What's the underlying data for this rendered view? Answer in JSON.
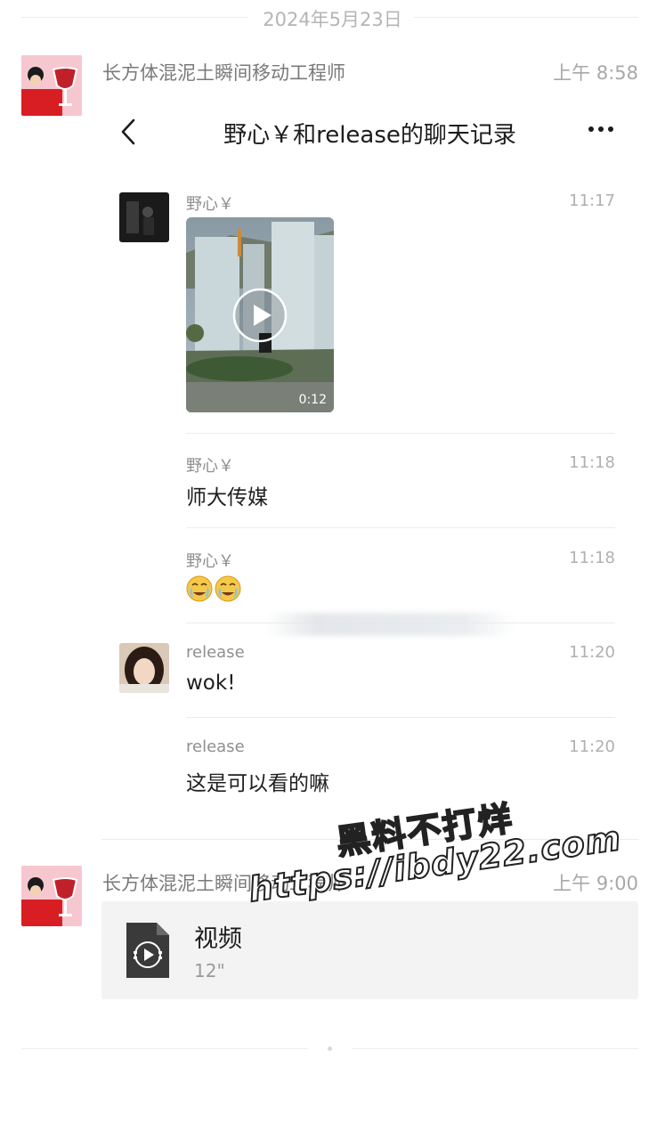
{
  "date_divider": "2024年5月23日",
  "records": [
    {
      "sender": "长方体混泥土瞬间移动工程师",
      "time": "上午 8:58",
      "chat_record": {
        "title": "野心￥和release的聊天记录",
        "messages": [
          {
            "name": "野心￥",
            "time": "11:17",
            "type": "video",
            "duration": "0:12"
          },
          {
            "name": "野心￥",
            "time": "11:18",
            "text": "师大传媒"
          },
          {
            "name": "野心￥",
            "time": "11:18",
            "type": "emoji",
            "emoji": "😭😭"
          },
          {
            "name": "release",
            "time": "11:20",
            "text": "wok!"
          },
          {
            "name": "release",
            "time": "11:20",
            "text": "这是可以看的嘛"
          }
        ]
      }
    },
    {
      "sender": "长方体混泥土瞬间移动工程师",
      "time": "上午 9:00",
      "file": {
        "title": "视频",
        "duration": "12\""
      }
    }
  ],
  "watermark": {
    "line1": "黑料不打烊",
    "line2": "https://ibdy22.com"
  },
  "icons": {
    "back": "chevron-left-icon",
    "more": "more-dots-icon",
    "file": "video-file-icon",
    "play": "play-icon"
  }
}
